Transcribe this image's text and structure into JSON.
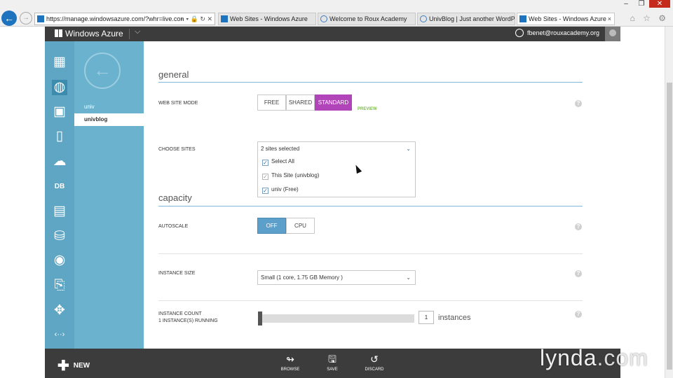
{
  "browser": {
    "address": "https://manage.windowsazure.com/?whr=live.con",
    "address_icons": "⌕ ▾ 🔒 ↻ ✕",
    "tabs": [
      {
        "label": "Web Sites - Windows Azure"
      },
      {
        "label": "Welcome to Roux Academy"
      },
      {
        "label": "UnivBlog | Just another WordP..."
      },
      {
        "label": "Web Sites - Windows Azure",
        "close": "×"
      }
    ],
    "window_controls": [
      "–",
      "❐",
      "✕"
    ],
    "toolbar_icons": "⌂ ☆ ⚙"
  },
  "header": {
    "brand": "Windows Azure",
    "caret": "⌵",
    "user": "fbenet@rouxacademy.org"
  },
  "icon_rail": [
    {
      "name": "all-items-icon",
      "glyph": "▦"
    },
    {
      "name": "web-sites-icon",
      "glyph": "◍"
    },
    {
      "name": "virtual-machines-icon",
      "glyph": "▣"
    },
    {
      "name": "mobile-services-icon",
      "glyph": "▯"
    },
    {
      "name": "cloud-services-icon",
      "glyph": "☁"
    },
    {
      "name": "sql-databases-icon",
      "glyph": "DB"
    },
    {
      "name": "storage-icon",
      "glyph": "▤"
    },
    {
      "name": "hdinsight-icon",
      "glyph": "⛁"
    },
    {
      "name": "media-services-icon",
      "glyph": "◉"
    },
    {
      "name": "service-bus-icon",
      "glyph": "⎘"
    },
    {
      "name": "networks-icon",
      "glyph": "✥"
    },
    {
      "name": "more-icon",
      "glyph": "‹··›"
    }
  ],
  "subnav": {
    "back_glyph": "←",
    "items": [
      {
        "label": "univ"
      },
      {
        "label": "univblog"
      }
    ]
  },
  "general": {
    "title": "general",
    "mode_label": "WEB SITE MODE",
    "modes": [
      "FREE",
      "SHARED",
      "STANDARD"
    ],
    "selected_mode": "STANDARD",
    "preview_tag": "PREVIEW",
    "choose_label": "CHOOSE SITES",
    "choose_value": "2 sites selected",
    "options": [
      {
        "label": "Select All",
        "checked": true
      },
      {
        "label": "This Site (univblog)",
        "checked": true,
        "disabled": true
      },
      {
        "label": "univ (Free)",
        "checked": true
      }
    ]
  },
  "capacity": {
    "title": "capacity",
    "autoscale_label": "AUTOSCALE",
    "autoscale_options": [
      "OFF",
      "CPU"
    ],
    "autoscale_selected": "OFF",
    "instance_size_label": "INSTANCE SIZE",
    "instance_size_value": "Small (1 core, 1.75 GB Memory )",
    "instance_count_label": "INSTANCE COUNT",
    "instance_running_label": "1 INSTANCE(S) RUNNING",
    "instance_count": "1",
    "instance_unit": "instances"
  },
  "help_glyph": "?",
  "chevron_glyph": "⌄",
  "check_glyph": "✓",
  "footer": {
    "new_label": "NEW",
    "new_glyph": "✚",
    "commands": [
      {
        "name": "browse",
        "label": "BROWSE",
        "glyph": "↬"
      },
      {
        "name": "save",
        "label": "SAVE",
        "glyph": "🖫"
      },
      {
        "name": "discard",
        "label": "DISCARD",
        "glyph": "↺"
      }
    ]
  },
  "watermark": {
    "brand": "lynda",
    "dom": ".com"
  },
  "colors": {
    "rail": "#5ea6c3",
    "subnav": "#6ab2cd",
    "magenta": "#b044b8",
    "blue": "#5c9fca"
  }
}
